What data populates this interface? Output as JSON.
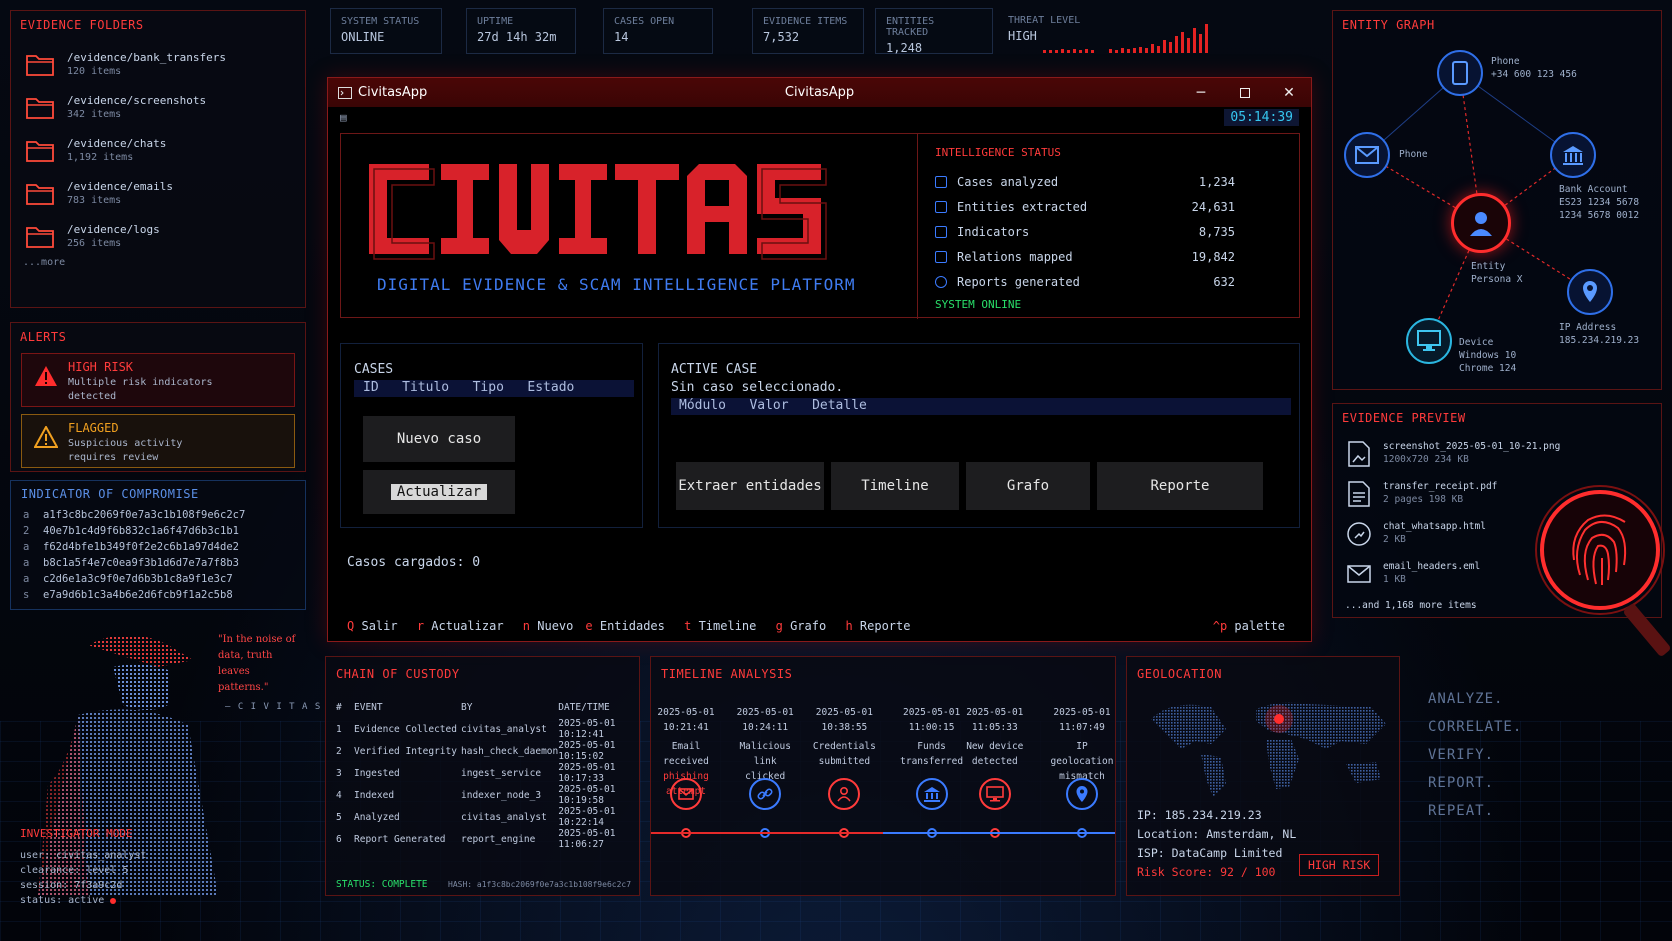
{
  "stats": [
    {
      "label": "SYSTEM STATUS",
      "value": "ONLINE"
    },
    {
      "label": "UPTIME",
      "value": "27d 14h 32m"
    },
    {
      "label": "CASES OPEN",
      "value": "14"
    },
    {
      "label": "EVIDENCE ITEMS",
      "value": "7,532"
    },
    {
      "label": "ENTITIES TRACKED",
      "value": "1,248"
    },
    {
      "label": "THREAT LEVEL",
      "value": "HIGH"
    }
  ],
  "folders": {
    "title": "EVIDENCE FOLDERS",
    "items": [
      {
        "path": "/evidence/bank_transfers",
        "count": "120 items"
      },
      {
        "path": "/evidence/screenshots",
        "count": "342 items"
      },
      {
        "path": "/evidence/chats",
        "count": "1,192 items"
      },
      {
        "path": "/evidence/emails",
        "count": "783 items"
      },
      {
        "path": "/evidence/logs",
        "count": "256 items"
      }
    ],
    "more": "...more"
  },
  "alerts": {
    "title": "ALERTS",
    "items": [
      {
        "title": "HIGH RISK",
        "desc1": "Multiple risk indicators",
        "desc2": "detected"
      },
      {
        "title": "FLAGGED",
        "desc1": "Suspicious activity",
        "desc2": "requires review"
      }
    ]
  },
  "ioc": {
    "title": "INDICATOR OF COMPROMISE",
    "items": [
      {
        "k": "a",
        "v": "a1f3c8bc2069f0e7a3c1b108f9e6c2c7"
      },
      {
        "k": "2",
        "v": "40e7b1c4d9f6b832c1a6f47d6b3c1b1"
      },
      {
        "k": "a",
        "v": "f62d4bfe1b349f0f2e2c6b1a97d4de2"
      },
      {
        "k": "a",
        "v": "b8c1a5f4e7c0ea9f3b1d6d7e7a7f8b3"
      },
      {
        "k": "a",
        "v": "c2d6e1a3c9f0e7d6b3b1c8a9f1e3c7"
      },
      {
        "k": "s",
        "v": "e7a9d6b1c3a4b6e2d6fcb9f1a2c5b8"
      }
    ]
  },
  "quote": {
    "text": "\"In the noise of data, truth leaves patterns.\"",
    "author": "— C I V I T A S"
  },
  "investigator": {
    "title": "INVESTIGATOR MODE",
    "user": "user: civitas_analyst",
    "clearance": "clearance: level 5",
    "session": "session: 7f3a9c2d",
    "status": "status: active"
  },
  "window": {
    "title_left": "CivitasApp",
    "title_center": "CivitasApp",
    "clock": "05:14:39",
    "logo": "CIVITAS",
    "subtitle": "DIGITAL EVIDENCE & SCAM INTELLIGENCE PLATFORM",
    "intel": {
      "title": "INTELLIGENCE STATUS",
      "rows": [
        {
          "label": "Cases analyzed",
          "value": "1,234"
        },
        {
          "label": "Entities extracted",
          "value": "24,631"
        },
        {
          "label": "Indicators",
          "value": "8,735"
        },
        {
          "label": "Relations mapped",
          "value": "19,842"
        },
        {
          "label": "Reports generated",
          "value": "632"
        }
      ],
      "online": "SYSTEM ONLINE"
    },
    "cases": {
      "title": "CASES",
      "cols": [
        "ID",
        "Titulo",
        "Tipo",
        "Estado"
      ],
      "new_btn": "Nuevo caso",
      "refresh_btn": "Actualizar"
    },
    "active": {
      "title": "ACTIVE CASE",
      "none": "Sin caso seleccionado.",
      "cols": [
        "Módulo",
        "Valor",
        "Detalle"
      ],
      "buttons": [
        "Extraer entidades",
        "Timeline",
        "Grafo",
        "Reporte"
      ]
    },
    "loaded": "Casos cargados: 0",
    "footer": [
      {
        "k": "Q",
        "l": "Salir"
      },
      {
        "k": "r",
        "l": "Actualizar"
      },
      {
        "k": "n",
        "l": "Nuevo"
      },
      {
        "k": "e",
        "l": "Entidades"
      },
      {
        "k": "t",
        "l": "Timeline"
      },
      {
        "k": "g",
        "l": "Grafo"
      },
      {
        "k": "h",
        "l": "Reporte"
      }
    ],
    "palette_key": "^p",
    "palette": "palette"
  },
  "custody": {
    "title": "CHAIN OF CUSTODY",
    "cols": [
      "#",
      "EVENT",
      "BY",
      "DATE/TIME"
    ],
    "rows": [
      {
        "n": "1",
        "e": "Evidence Collected",
        "b": "civitas_analyst",
        "d": "2025-05-01 10:12:41"
      },
      {
        "n": "2",
        "e": "Verified Integrity",
        "b": "hash_check_daemon",
        "d": "2025-05-01 10:15:02"
      },
      {
        "n": "3",
        "e": "Ingested",
        "b": "ingest_service",
        "d": "2025-05-01 10:17:33"
      },
      {
        "n": "4",
        "e": "Indexed",
        "b": "indexer_node_3",
        "d": "2025-05-01 10:19:58"
      },
      {
        "n": "5",
        "e": "Analyzed",
        "b": "civitas_analyst",
        "d": "2025-05-01 10:22:14"
      },
      {
        "n": "6",
        "e": "Report Generated",
        "b": "report_engine",
        "d": "2025-05-01 11:06:27"
      }
    ],
    "status": "STATUS: COMPLETE",
    "hash": "HASH: a1f3c8bc2069f0e7a3c1b108f9e6c2c7"
  },
  "timeline": {
    "title": "TIMELINE ANALYSIS",
    "items": [
      {
        "date": "2025-05-01",
        "time": "10:21:41",
        "l1": "Email received",
        "l2": "phishing attempt",
        "icon": "mail-icon",
        "color": "#ff3b3b"
      },
      {
        "date": "2025-05-01",
        "time": "10:24:11",
        "l1": "Malicious link",
        "l2": "clicked",
        "icon": "link-icon",
        "color": "#3b7bff"
      },
      {
        "date": "2025-05-01",
        "time": "10:38:55",
        "l1": "Credentials",
        "l2": "submitted",
        "icon": "user-icon",
        "color": "#ff3b3b"
      },
      {
        "date": "2025-05-01",
        "time": "11:00:15",
        "l1": "Funds",
        "l2": "transferred",
        "icon": "bank-icon",
        "color": "#3b7bff"
      },
      {
        "date": "2025-05-01",
        "time": "11:05:33",
        "l1": "New device",
        "l2": "detected",
        "icon": "monitor-icon",
        "color": "#ff3b3b"
      },
      {
        "date": "2025-05-01",
        "time": "11:07:49",
        "l1": "IP geolocation",
        "l2": "mismatch",
        "icon": "pin-icon",
        "color": "#3b7bff"
      }
    ]
  },
  "geo": {
    "title": "GEOLOCATION",
    "ip": "IP: 185.234.219.23",
    "location": "Location: Amsterdam, NL",
    "isp": "ISP: DataCamp Limited",
    "risk": "Risk Score: 92 / 100",
    "badge": "HIGH RISK"
  },
  "mantra": [
    "ANALYZE.",
    "CORRELATE.",
    "VERIFY.",
    "REPORT.",
    "REPEAT."
  ],
  "graph": {
    "title": "ENTITY GRAPH",
    "nodes": [
      {
        "l1": "Phone",
        "l2": "+34 600 123 456"
      },
      {
        "l1": "Phone",
        "l2": ""
      },
      {
        "l1": "Bank Account",
        "l2": "ES23 1234 5678",
        "l3": "1234 5678 0012"
      },
      {
        "l1": "Entity",
        "l2": "Persona X"
      },
      {
        "l1": "IP Address",
        "l2": "185.234.219.23"
      },
      {
        "l1": "Device",
        "l2": "Windows 10",
        "l3": "Chrome 124"
      }
    ]
  },
  "preview": {
    "title": "EVIDENCE PREVIEW",
    "items": [
      {
        "name": "screenshot_2025-05-01_10-21.png",
        "meta": "1200x720  234 KB"
      },
      {
        "name": "transfer_receipt.pdf",
        "meta": "2 pages  198 KB"
      },
      {
        "name": "chat_whatsapp.html",
        "meta": "2 KB"
      },
      {
        "name": "email_headers.eml",
        "meta": "1 KB"
      }
    ],
    "more": "...and 1,168 more items"
  }
}
